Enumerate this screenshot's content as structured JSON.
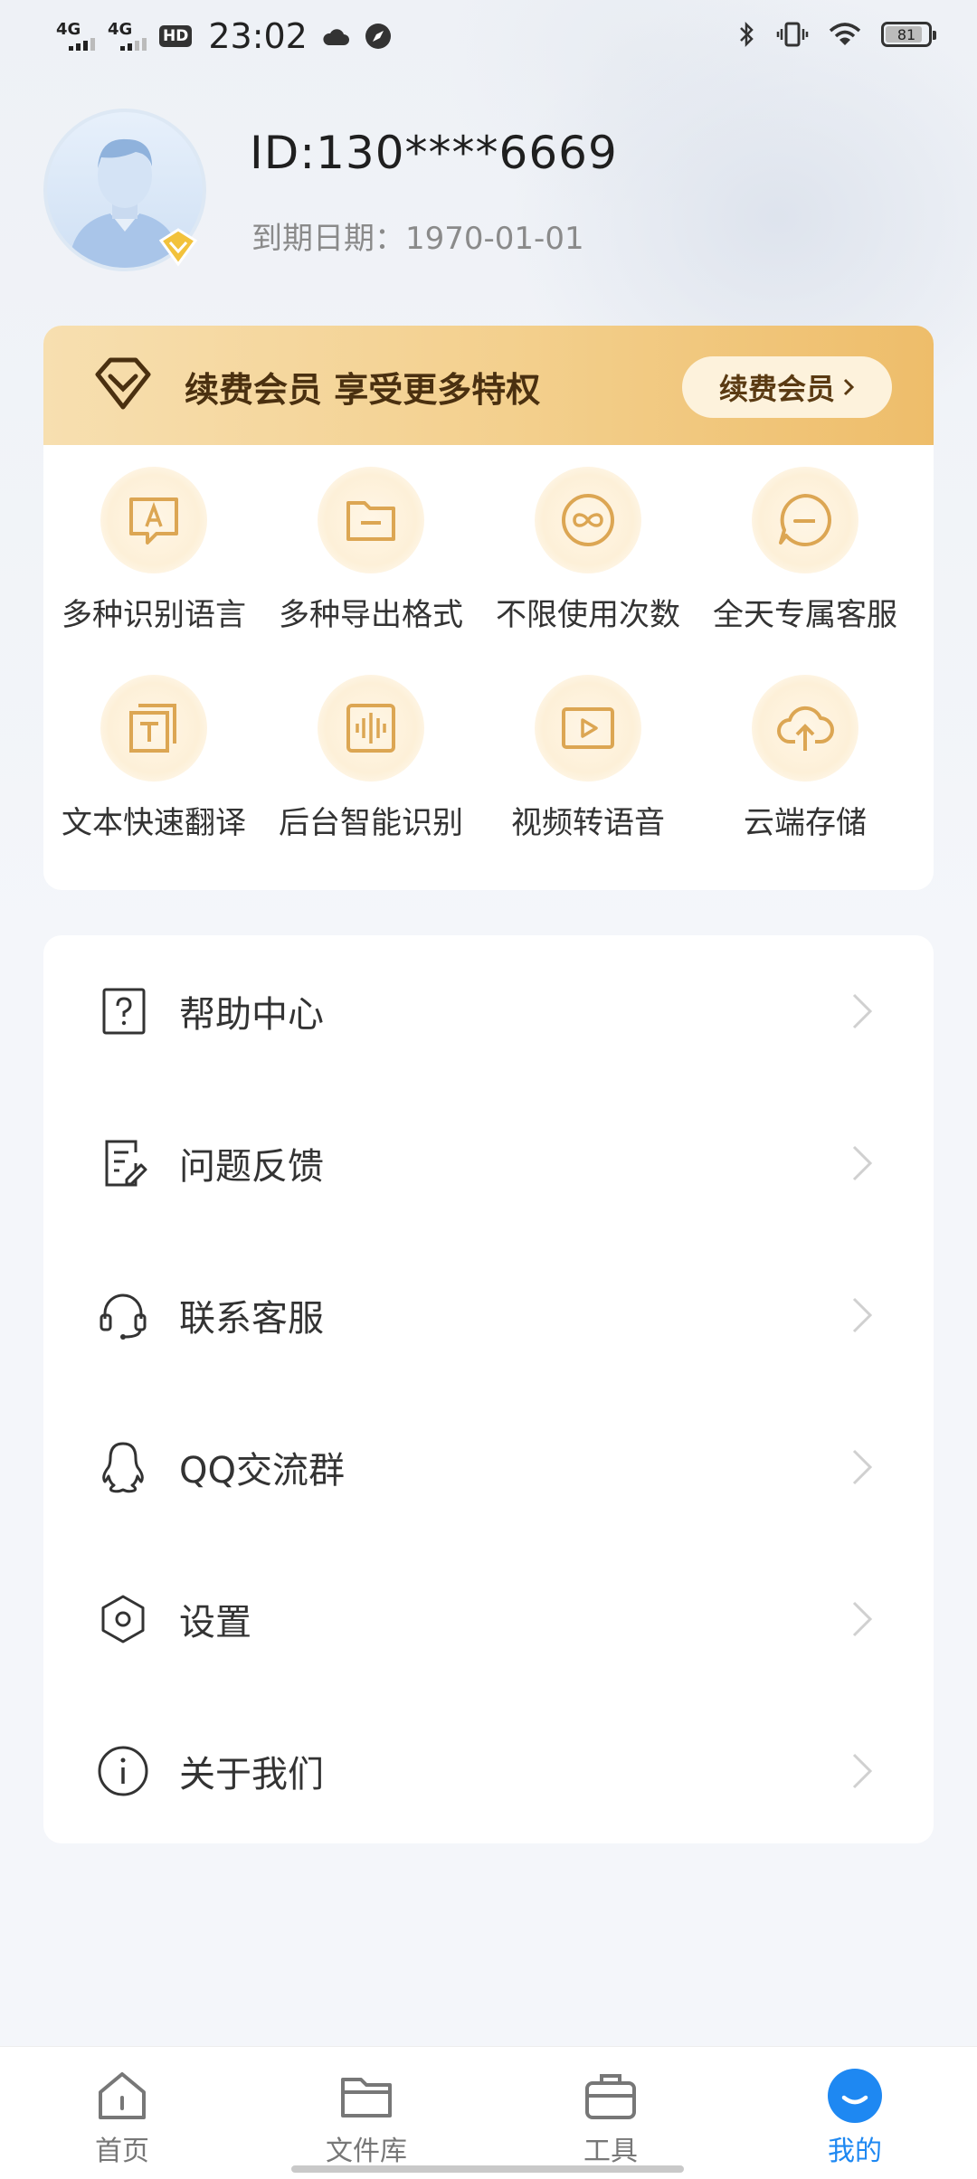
{
  "status_bar": {
    "network1": "4G",
    "network2": "4G",
    "hd": "HD",
    "time": "23:02",
    "battery": "81"
  },
  "profile": {
    "id_text": "ID:130****6669",
    "expiry_text": "到期日期：1970-01-01"
  },
  "vip": {
    "banner_text": "续费会员 享受更多特权",
    "renew_button": "续费会员",
    "features": [
      {
        "label": "多种识别语言",
        "icon": "language-icon"
      },
      {
        "label": "多种导出格式",
        "icon": "folder-icon"
      },
      {
        "label": "不限使用次数",
        "icon": "infinity-icon"
      },
      {
        "label": "全天专属客服",
        "icon": "chat-icon"
      },
      {
        "label": "文本快速翻译",
        "icon": "translate-icon"
      },
      {
        "label": "后台智能识别",
        "icon": "waveform-icon"
      },
      {
        "label": "视频转语音",
        "icon": "video-icon"
      },
      {
        "label": "云端存储",
        "icon": "cloud-upload-icon"
      }
    ]
  },
  "menu": [
    {
      "label": "帮助中心",
      "icon": "help-icon"
    },
    {
      "label": "问题反馈",
      "icon": "feedback-icon"
    },
    {
      "label": "联系客服",
      "icon": "headset-icon"
    },
    {
      "label": "QQ交流群",
      "icon": "qq-icon"
    },
    {
      "label": "设置",
      "icon": "settings-icon"
    },
    {
      "label": "关于我们",
      "icon": "info-icon"
    }
  ],
  "tabs": [
    {
      "label": "首页",
      "icon": "home-icon",
      "active": false
    },
    {
      "label": "文件库",
      "icon": "folder-icon",
      "active": false
    },
    {
      "label": "工具",
      "icon": "toolbox-icon",
      "active": false
    },
    {
      "label": "我的",
      "icon": "profile-icon",
      "active": true
    }
  ],
  "colors": {
    "accent": "#1e88f2",
    "gold": "#d9a24a",
    "gold_dark": "#4a3010"
  }
}
